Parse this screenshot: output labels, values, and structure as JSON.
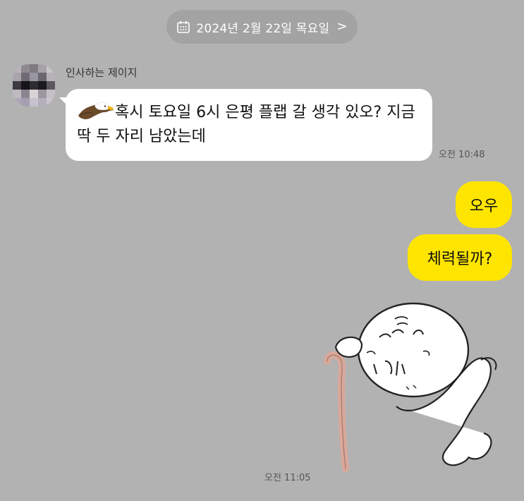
{
  "date_divider": {
    "label": "2024년 2월 22일 목요일",
    "chevron": ">",
    "icon": "calendar-icon"
  },
  "incoming": {
    "sender_name": "인사하는 제이지",
    "avatar_icon": "pixelated-avatar",
    "emoticon_icon": "eagle-icon",
    "text": "혹시 토요일 6시 은평 플랩 갈 생각 있오? 지금 딱 두 자리 남았는데",
    "time": "오전 10:48"
  },
  "outgoing": [
    {
      "text": "오우"
    },
    {
      "text": "체력될까?"
    }
  ],
  "sticker": {
    "icon": "old-man-cane-sticker",
    "time": "오전 11:05"
  },
  "colors": {
    "background": "#b2b2b2",
    "incoming_bubble": "#ffffff",
    "outgoing_bubble": "#fee500",
    "date_pill": "#a3a3a3"
  }
}
